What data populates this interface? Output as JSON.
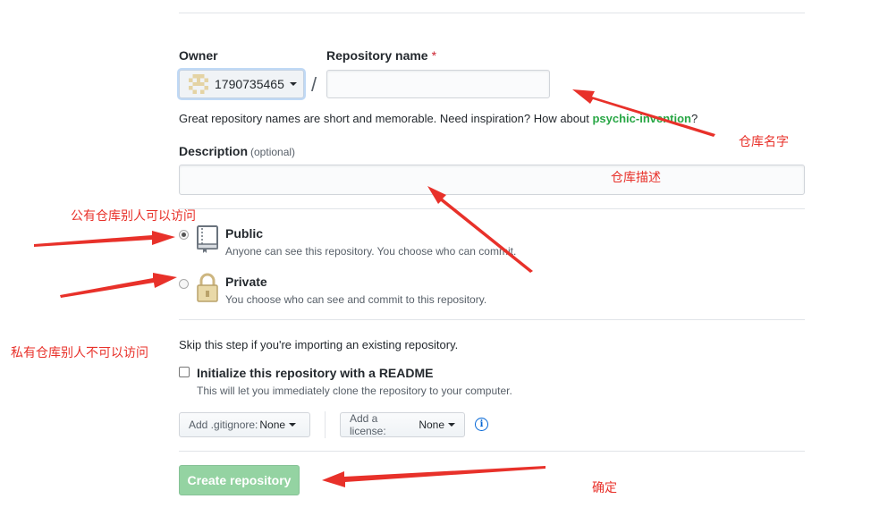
{
  "owner": {
    "label": "Owner",
    "value": "1790735465"
  },
  "repo_name": {
    "label": "Repository name",
    "required_mark": "*",
    "value": ""
  },
  "slash": "/",
  "name_hint": {
    "prefix": "Great repository names are short and memorable. Need inspiration? How about ",
    "suggestion": "psychic-invention",
    "suffix": "?"
  },
  "description": {
    "label": "Description",
    "optional": "(optional)",
    "value": ""
  },
  "visibility": {
    "selected": "public",
    "public": {
      "title": "Public",
      "subtitle": "Anyone can see this repository. You choose who can commit."
    },
    "private": {
      "title": "Private",
      "subtitle": "You choose who can see and commit to this repository."
    }
  },
  "init": {
    "skip_note": "Skip this step if you're importing an existing repository.",
    "readme_label": "Initialize this repository with a README",
    "readme_sub": "This will let you immediately clone the repository to your computer.",
    "readme_checked": false
  },
  "gitignore": {
    "prefix": "Add .gitignore:",
    "value": "None"
  },
  "license": {
    "prefix": "Add a license:",
    "value": "None"
  },
  "create_button": "Create repository",
  "annotations": {
    "repo_name": "仓库名字",
    "description": "仓库描述",
    "public": "公有仓库别人可以访问",
    "private": "私有仓库别人不可以访问",
    "confirm": "确定"
  },
  "colors": {
    "arrow": "#e8312a",
    "create_button": "#94d3a2",
    "suggestion": "#28a745",
    "info": "#0366d6"
  },
  "icons": [
    "repo-book-icon",
    "lock-icon",
    "info-icon",
    "caret-down-icon",
    "identicon-avatar"
  ]
}
